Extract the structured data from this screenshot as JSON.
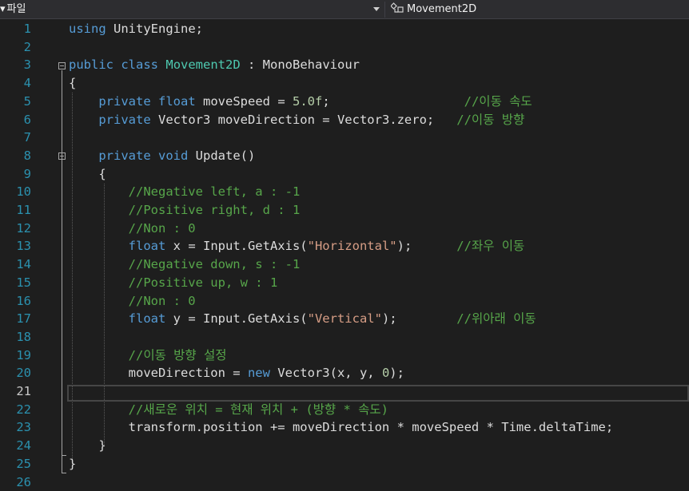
{
  "navbar": {
    "file_label": "파일",
    "member_label": "Movement2D",
    "member_icon": "class-members-icon"
  },
  "editor": {
    "current_line": 21,
    "lines": [
      {
        "n": "1",
        "tokens": [
          {
            "t": "using",
            "c": "kw"
          },
          {
            "t": " UnityEngine;"
          }
        ]
      },
      {
        "n": "2",
        "tokens": []
      },
      {
        "n": "3",
        "tokens": [
          {
            "t": "public",
            "c": "kw"
          },
          {
            "t": " "
          },
          {
            "t": "class",
            "c": "kw"
          },
          {
            "t": " "
          },
          {
            "t": "Movement2D",
            "c": "ty"
          },
          {
            "t": " : MonoBehaviour"
          }
        ]
      },
      {
        "n": "4",
        "tokens": [
          {
            "t": "{"
          }
        ]
      },
      {
        "n": "5",
        "tokens": [
          {
            "t": "    "
          },
          {
            "t": "private",
            "c": "kw"
          },
          {
            "t": " "
          },
          {
            "t": "float",
            "c": "kw"
          },
          {
            "t": " moveSpeed = "
          },
          {
            "t": "5.0f",
            "c": "nm"
          },
          {
            "t": ";                  "
          },
          {
            "t": "//이동 속도",
            "c": "cm"
          }
        ]
      },
      {
        "n": "6",
        "tokens": [
          {
            "t": "    "
          },
          {
            "t": "private",
            "c": "kw"
          },
          {
            "t": " Vector3 moveDirection = Vector3.zero;   "
          },
          {
            "t": "//이동 방향",
            "c": "cm"
          }
        ]
      },
      {
        "n": "7",
        "tokens": []
      },
      {
        "n": "8",
        "tokens": [
          {
            "t": "    "
          },
          {
            "t": "private",
            "c": "kw"
          },
          {
            "t": " "
          },
          {
            "t": "void",
            "c": "kw"
          },
          {
            "t": " Update()"
          }
        ]
      },
      {
        "n": "9",
        "tokens": [
          {
            "t": "    {"
          }
        ]
      },
      {
        "n": "10",
        "tokens": [
          {
            "t": "        "
          },
          {
            "t": "//Negative left, a : -1",
            "c": "cm"
          }
        ]
      },
      {
        "n": "11",
        "tokens": [
          {
            "t": "        "
          },
          {
            "t": "//Positive right, d : 1",
            "c": "cm"
          }
        ]
      },
      {
        "n": "12",
        "tokens": [
          {
            "t": "        "
          },
          {
            "t": "//Non : 0",
            "c": "cm"
          }
        ]
      },
      {
        "n": "13",
        "tokens": [
          {
            "t": "        "
          },
          {
            "t": "float",
            "c": "kw"
          },
          {
            "t": " x = Input.GetAxis("
          },
          {
            "t": "\"Horizontal\"",
            "c": "st"
          },
          {
            "t": ");      "
          },
          {
            "t": "//좌우 이동",
            "c": "cm"
          }
        ]
      },
      {
        "n": "14",
        "tokens": [
          {
            "t": "        "
          },
          {
            "t": "//Negative down, s : -1",
            "c": "cm"
          }
        ]
      },
      {
        "n": "15",
        "tokens": [
          {
            "t": "        "
          },
          {
            "t": "//Positive up, w : 1",
            "c": "cm"
          }
        ]
      },
      {
        "n": "16",
        "tokens": [
          {
            "t": "        "
          },
          {
            "t": "//Non : 0",
            "c": "cm"
          }
        ]
      },
      {
        "n": "17",
        "tokens": [
          {
            "t": "        "
          },
          {
            "t": "float",
            "c": "kw"
          },
          {
            "t": " y = Input.GetAxis("
          },
          {
            "t": "\"Vertical\"",
            "c": "st"
          },
          {
            "t": ");        "
          },
          {
            "t": "//위아래 이동",
            "c": "cm"
          }
        ]
      },
      {
        "n": "18",
        "tokens": []
      },
      {
        "n": "19",
        "tokens": [
          {
            "t": "        "
          },
          {
            "t": "//이동 방향 설정",
            "c": "cm"
          }
        ]
      },
      {
        "n": "20",
        "tokens": [
          {
            "t": "        moveDirection = "
          },
          {
            "t": "new",
            "c": "kw"
          },
          {
            "t": " Vector3(x, y, "
          },
          {
            "t": "0",
            "c": "nm"
          },
          {
            "t": ");"
          }
        ]
      },
      {
        "n": "21",
        "tokens": []
      },
      {
        "n": "22",
        "tokens": [
          {
            "t": "        "
          },
          {
            "t": "//새로운 위치 = 현재 위치 + (방향 * 속도)",
            "c": "cm"
          }
        ]
      },
      {
        "n": "23",
        "tokens": [
          {
            "t": "        transform.position += moveDirection * moveSpeed * Time.deltaTime;"
          }
        ]
      },
      {
        "n": "24",
        "tokens": [
          {
            "t": "    }"
          }
        ]
      },
      {
        "n": "25",
        "tokens": [
          {
            "t": "}"
          }
        ]
      },
      {
        "n": "26",
        "tokens": []
      }
    ]
  }
}
